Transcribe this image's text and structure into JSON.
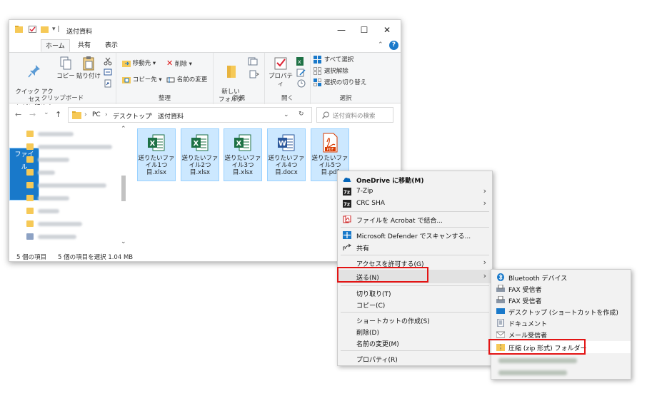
{
  "window": {
    "title": "送付資料",
    "minimize": "—",
    "maximize": "☐",
    "close": "✕",
    "quick_access_sep": "▾ |"
  },
  "ribbon_tabs": [
    "ファイル",
    "ホーム",
    "共有",
    "表示"
  ],
  "ribbon_help": "?",
  "ribbon_expand": "⌃",
  "ribbon": {
    "clipboard": {
      "label": "クリップボード",
      "pin": "クイック アクセス\nにピン留めする",
      "copy": "コピー",
      "paste": "貼り付け"
    },
    "organize": {
      "label": "整理",
      "move_to": "移動先 ▾",
      "copy_to": "コピー先 ▾",
      "delete": "削除 ▾",
      "rename": "名前の変更"
    },
    "new": {
      "label": "新規",
      "new_folder": "新しい\nフォルダー"
    },
    "open": {
      "label": "開く",
      "properties": "プロパティ"
    },
    "select": {
      "label": "選択",
      "select_all": "すべて選択",
      "select_none": "選択解除",
      "invert": "選択の切り替え"
    }
  },
  "address": {
    "crumbs": [
      "PC",
      "デスクトップ",
      "送付資料"
    ],
    "sep": "›",
    "search_placeholder": "送付資料の検索",
    "back": "←",
    "forward": "→",
    "recent": "⌄",
    "up": "↑",
    "dropdown": "⌄",
    "refresh": "↻"
  },
  "files": [
    {
      "name": "送りたいファイル1つ目.xlsx",
      "type": "xlsx"
    },
    {
      "name": "送りたいファイル2つ目.xlsx",
      "type": "xlsx"
    },
    {
      "name": "送りたいファイル3つ目.xlsx",
      "type": "xlsx"
    },
    {
      "name": "送りたいファイル4つ目.docx",
      "type": "docx"
    },
    {
      "name": "送りたいファイル5つ目.pdf",
      "type": "pdf"
    }
  ],
  "status": {
    "count": "5 個の項目",
    "selected": "5 個の項目を選択  1.04 MB"
  },
  "context_menu": [
    {
      "label": "OneDrive に移動(M)",
      "icon": "onedrive-icon",
      "bold": true
    },
    {
      "label": "7-Zip",
      "icon": "sevenzip-icon",
      "arrow": true
    },
    {
      "label": "CRC SHA",
      "icon": "sevenzip-icon",
      "arrow": true
    },
    {
      "label": "ファイルを Acrobat で結合...",
      "icon": "acrobat-icon"
    },
    {
      "label": "Microsoft Defender でスキャンする...",
      "icon": "defender-icon"
    },
    {
      "label": "共有",
      "icon": "share-icon"
    },
    {
      "label": "アクセスを許可する(G)",
      "arrow": true
    },
    {
      "label": "送る(N)",
      "arrow": true
    },
    {
      "label": "切り取り(T)"
    },
    {
      "label": "コピー(C)"
    },
    {
      "label": "ショートカットの作成(S)"
    },
    {
      "label": "削除(D)"
    },
    {
      "label": "名前の変更(M)"
    },
    {
      "label": "プロパティ(R)"
    }
  ],
  "arrow_glyph": "›",
  "send_to_menu": [
    {
      "label": "Bluetooth デバイス",
      "icon": "bluetooth-icon"
    },
    {
      "label": "FAX 受信者",
      "icon": "fax-icon"
    },
    {
      "label": "FAX 受信者",
      "icon": "fax-icon"
    },
    {
      "label": "デスクトップ (ショートカットを作成)",
      "icon": "desktop-icon"
    },
    {
      "label": "ドキュメント",
      "icon": "document-icon"
    },
    {
      "label": "メール受信者",
      "icon": "mail-icon"
    },
    {
      "label": "圧縮 (zip 形式) フォルダー",
      "icon": "zip-folder-icon"
    }
  ],
  "colors": {
    "accent": "#1979ca",
    "selection": "#cce8ff",
    "highlight_box": "#e31414",
    "excel": "#1e7145",
    "word": "#2b579a",
    "pdf": "#d83b01"
  }
}
